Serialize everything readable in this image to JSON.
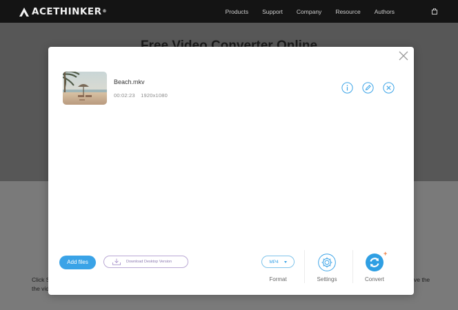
{
  "site": {
    "logo_text": "ACETHINKER",
    "logo_mark": "®",
    "nav": [
      "Products",
      "Support",
      "Company",
      "Resource",
      "Authors"
    ],
    "hero_title": "Free Video Converter Online",
    "bg_text_left": [
      "Click S",
      "the video c"
    ],
    "bg_text_right": [
      "ve the",
      ""
    ]
  },
  "modal": {
    "file": {
      "name": "Beach.mkv",
      "duration": "00:02:23",
      "resolution": "1920x1080"
    },
    "add_files_label": "Add files",
    "download_label": "Download Desktop Version",
    "format_value": "MP4",
    "format_label": "Format",
    "settings_label": "Settings",
    "convert_label": "Convert",
    "convert_badge": "+"
  },
  "colors": {
    "accent": "#3aa3e7",
    "topbar": "#141414",
    "download_border": "#b9a7d4",
    "convert_badge": "#f07a3b"
  }
}
